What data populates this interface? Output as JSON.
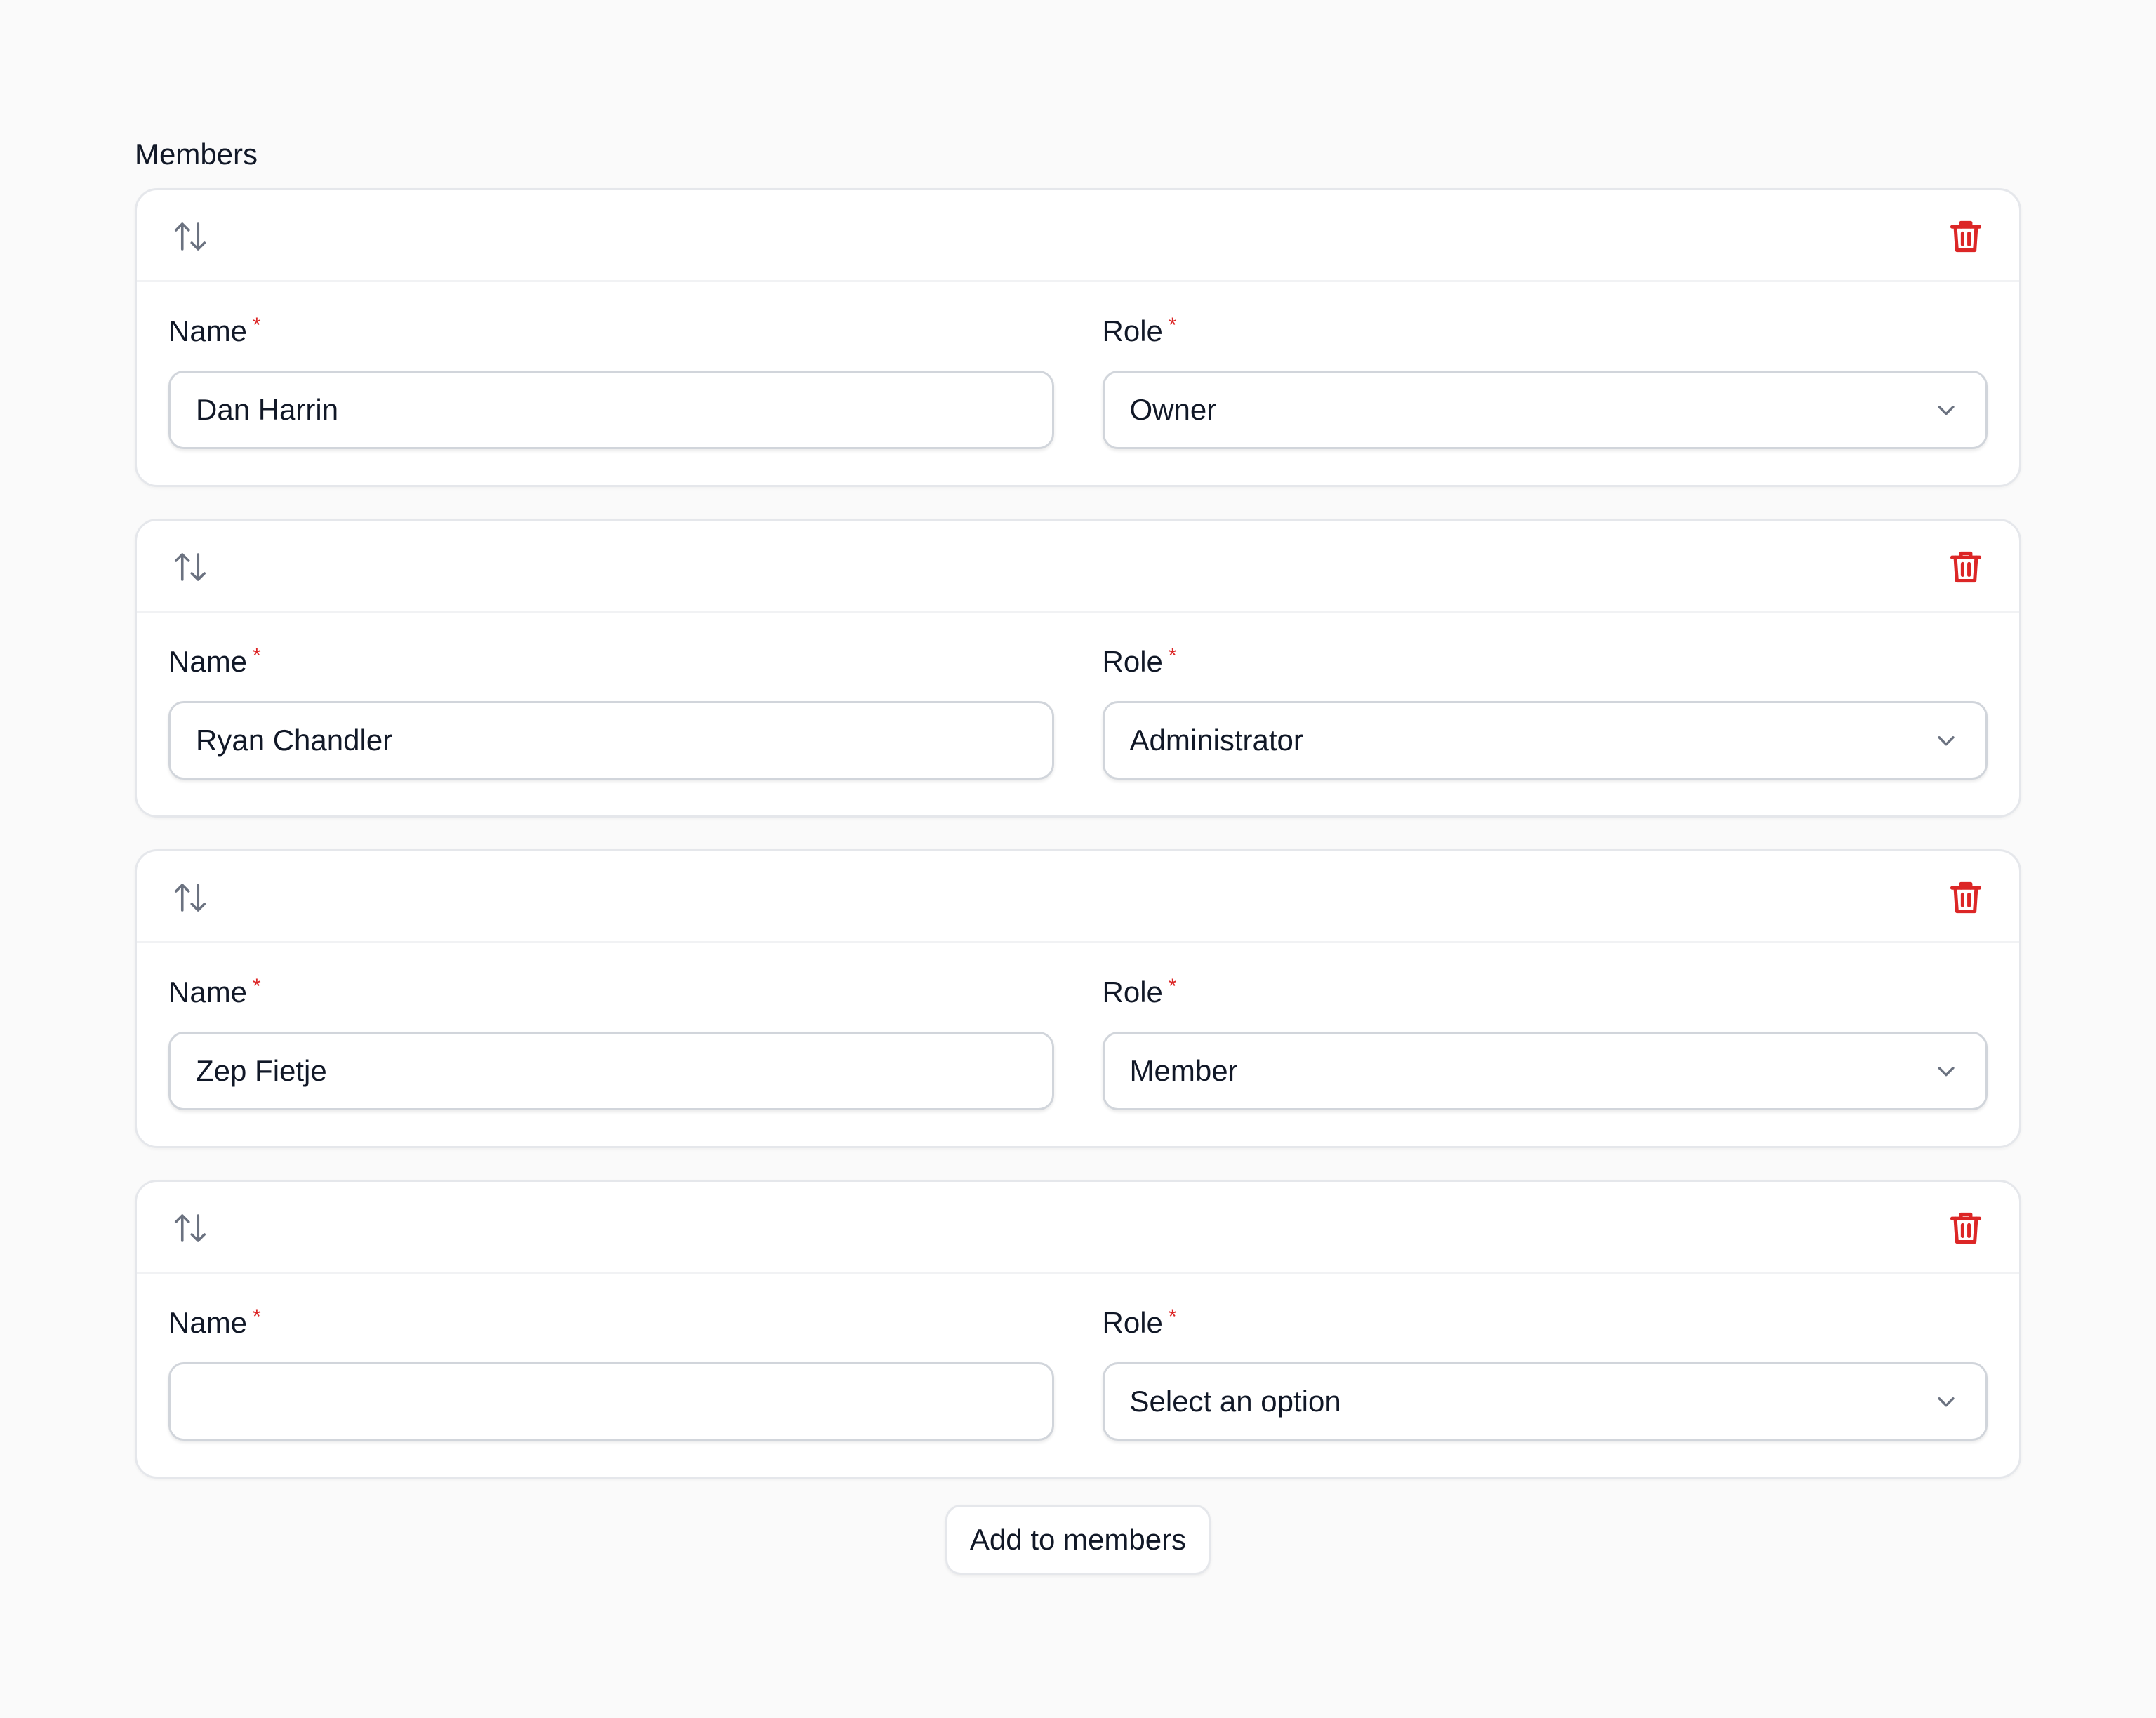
{
  "section_label": "Members",
  "add_button_label": "Add to members",
  "colors": {
    "danger": "#dc2626",
    "handle": "#6b7280",
    "required": "#dc2626"
  },
  "icons": {
    "reorder": "arrows-up-down-icon",
    "delete": "trash-icon",
    "dropdown": "chevron-down-icon"
  },
  "items": [
    {
      "name_label": "Name",
      "name_required": "*",
      "name_value": "Dan Harrin",
      "role_label": "Role",
      "role_required": "*",
      "role_value": "Owner"
    },
    {
      "name_label": "Name",
      "name_required": "*",
      "name_value": "Ryan Chandler",
      "role_label": "Role",
      "role_required": "*",
      "role_value": "Administrator"
    },
    {
      "name_label": "Name",
      "name_required": "*",
      "name_value": "Zep Fietje",
      "role_label": "Role",
      "role_required": "*",
      "role_value": "Member"
    },
    {
      "name_label": "Name",
      "name_required": "*",
      "name_value": "",
      "role_label": "Role",
      "role_required": "*",
      "role_value": "Select an option"
    }
  ]
}
